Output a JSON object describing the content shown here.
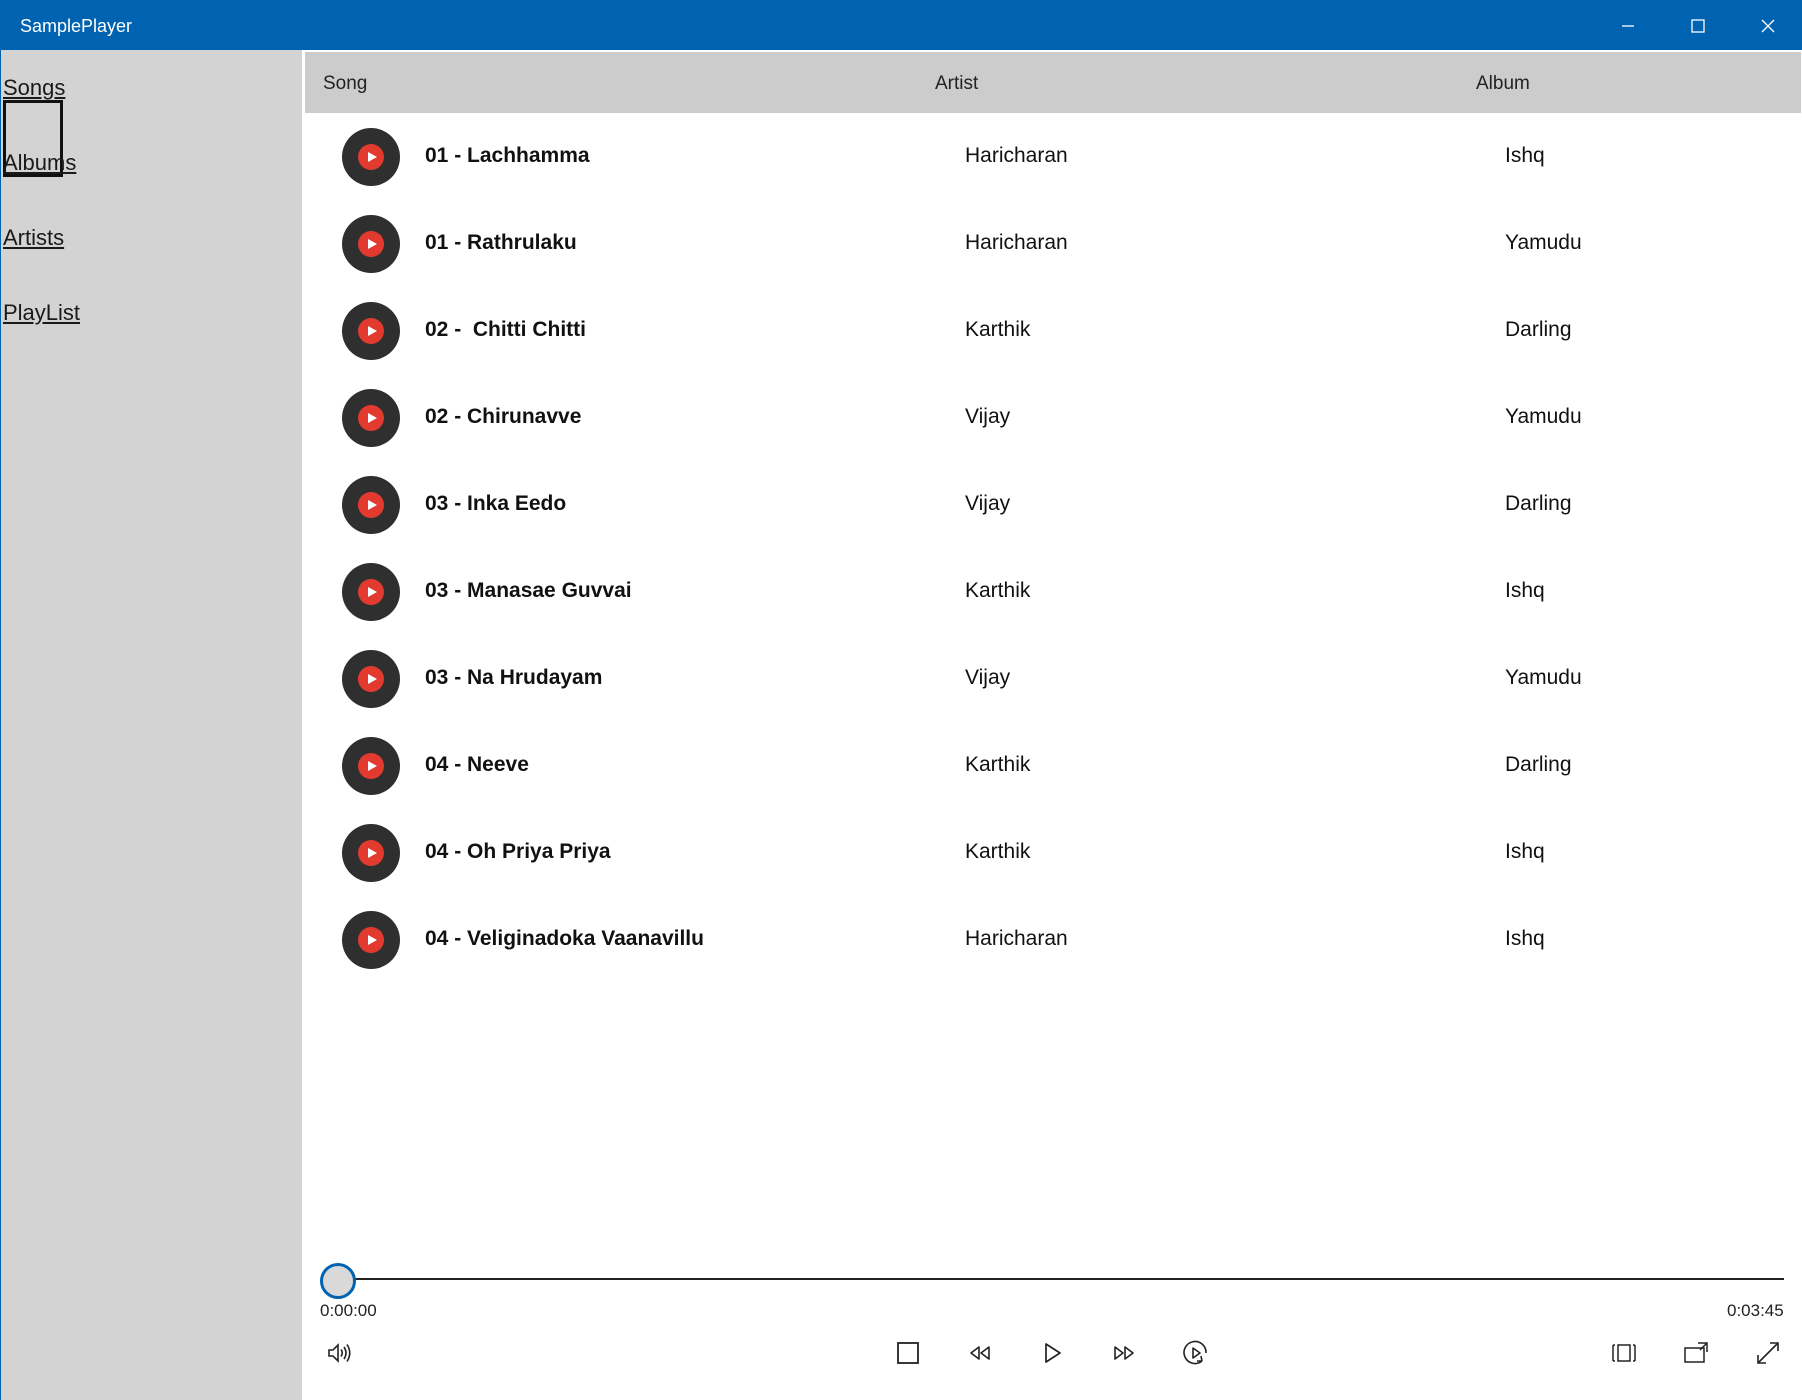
{
  "window": {
    "title": "SamplePlayer"
  },
  "caption": {
    "minimize": "minimize-icon",
    "maximize": "maximize-icon",
    "close": "close-icon"
  },
  "sidebar": {
    "items": [
      {
        "label": "Songs",
        "selected": true
      },
      {
        "label": "Albums",
        "selected": false
      },
      {
        "label": "Artists",
        "selected": false
      },
      {
        "label": "PlayList",
        "selected": false
      }
    ]
  },
  "table": {
    "columns": [
      "Song",
      "Artist",
      "Album"
    ],
    "rows": [
      {
        "song": "01 - Lachhamma",
        "artist": "Haricharan",
        "album": "Ishq"
      },
      {
        "song": "01 - Rathrulaku",
        "artist": "Haricharan",
        "album": "Yamudu"
      },
      {
        "song": "02 -  Chitti Chitti",
        "artist": "Karthik",
        "album": "Darling"
      },
      {
        "song": "02 - Chirunavve",
        "artist": "Vijay",
        "album": "Yamudu"
      },
      {
        "song": "03 - Inka Eedo",
        "artist": "Vijay",
        "album": "Darling"
      },
      {
        "song": "03 - Manasae Guvvai",
        "artist": "Karthik",
        "album": "Ishq"
      },
      {
        "song": "03 - Na Hrudayam",
        "artist": "Vijay",
        "album": "Yamudu"
      },
      {
        "song": "04 - Neeve",
        "artist": "Karthik",
        "album": "Darling"
      },
      {
        "song": "04 - Oh Priya Priya",
        "artist": "Karthik",
        "album": "Ishq"
      },
      {
        "song": "04 - Veliginadoka Vaanavillu",
        "artist": "Haricharan",
        "album": "Ishq"
      }
    ]
  },
  "player": {
    "elapsed": "0:00:00",
    "duration": "0:03:45",
    "progress": 0,
    "controls": [
      "volume-icon",
      "stop-icon",
      "rewind-icon",
      "play-icon",
      "fast-forward-icon",
      "repeat-icon",
      "aspect-ratio-icon",
      "cast-icon",
      "fullscreen-icon"
    ]
  },
  "colors": {
    "titlebar": "#0063b1",
    "sidebar": "#d3d3d3",
    "header": "#cccccc",
    "disc": "#2f2f2f",
    "disc_center": "#e23a2e"
  }
}
